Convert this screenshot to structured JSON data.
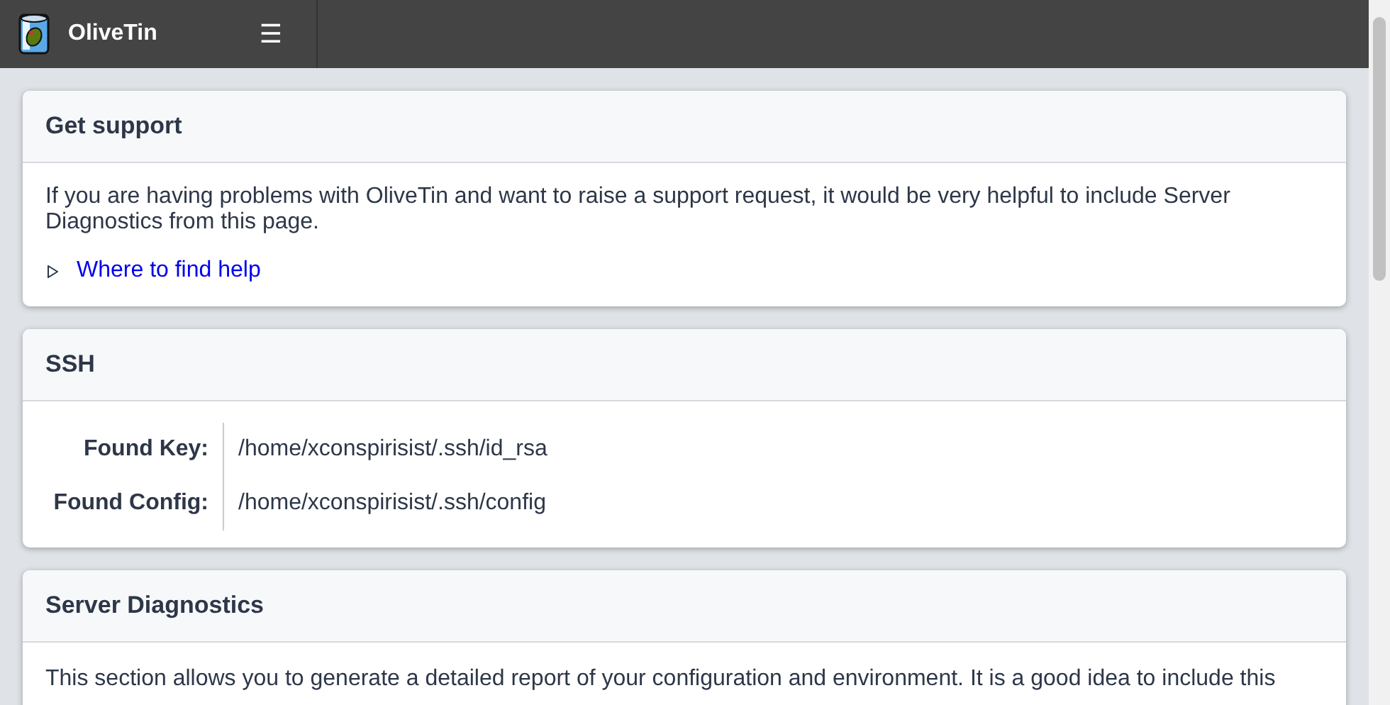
{
  "header": {
    "title": "OliveTin",
    "menu_icon": "☰"
  },
  "sections": [
    {
      "kind": "support",
      "title": "Get support",
      "text": "If you are having problems with OliveTin and want to raise a support request, it would be very helpful to include Server Diagnostics from this page.",
      "details": {
        "label": "Where to find help",
        "expanded": false
      }
    },
    {
      "kind": "table",
      "title": "SSH",
      "rows": [
        {
          "label": "Found Key:",
          "value": "/home/xconspirisist/.ssh/id_rsa"
        },
        {
          "label": "Found Config:",
          "value": "/home/xconspirisist/.ssh/config"
        }
      ]
    },
    {
      "kind": "text",
      "title": "Server Diagnostics",
      "text": "This section allows you to generate a detailed report of your configuration and environment. It is a good idea to include this"
    }
  ]
}
